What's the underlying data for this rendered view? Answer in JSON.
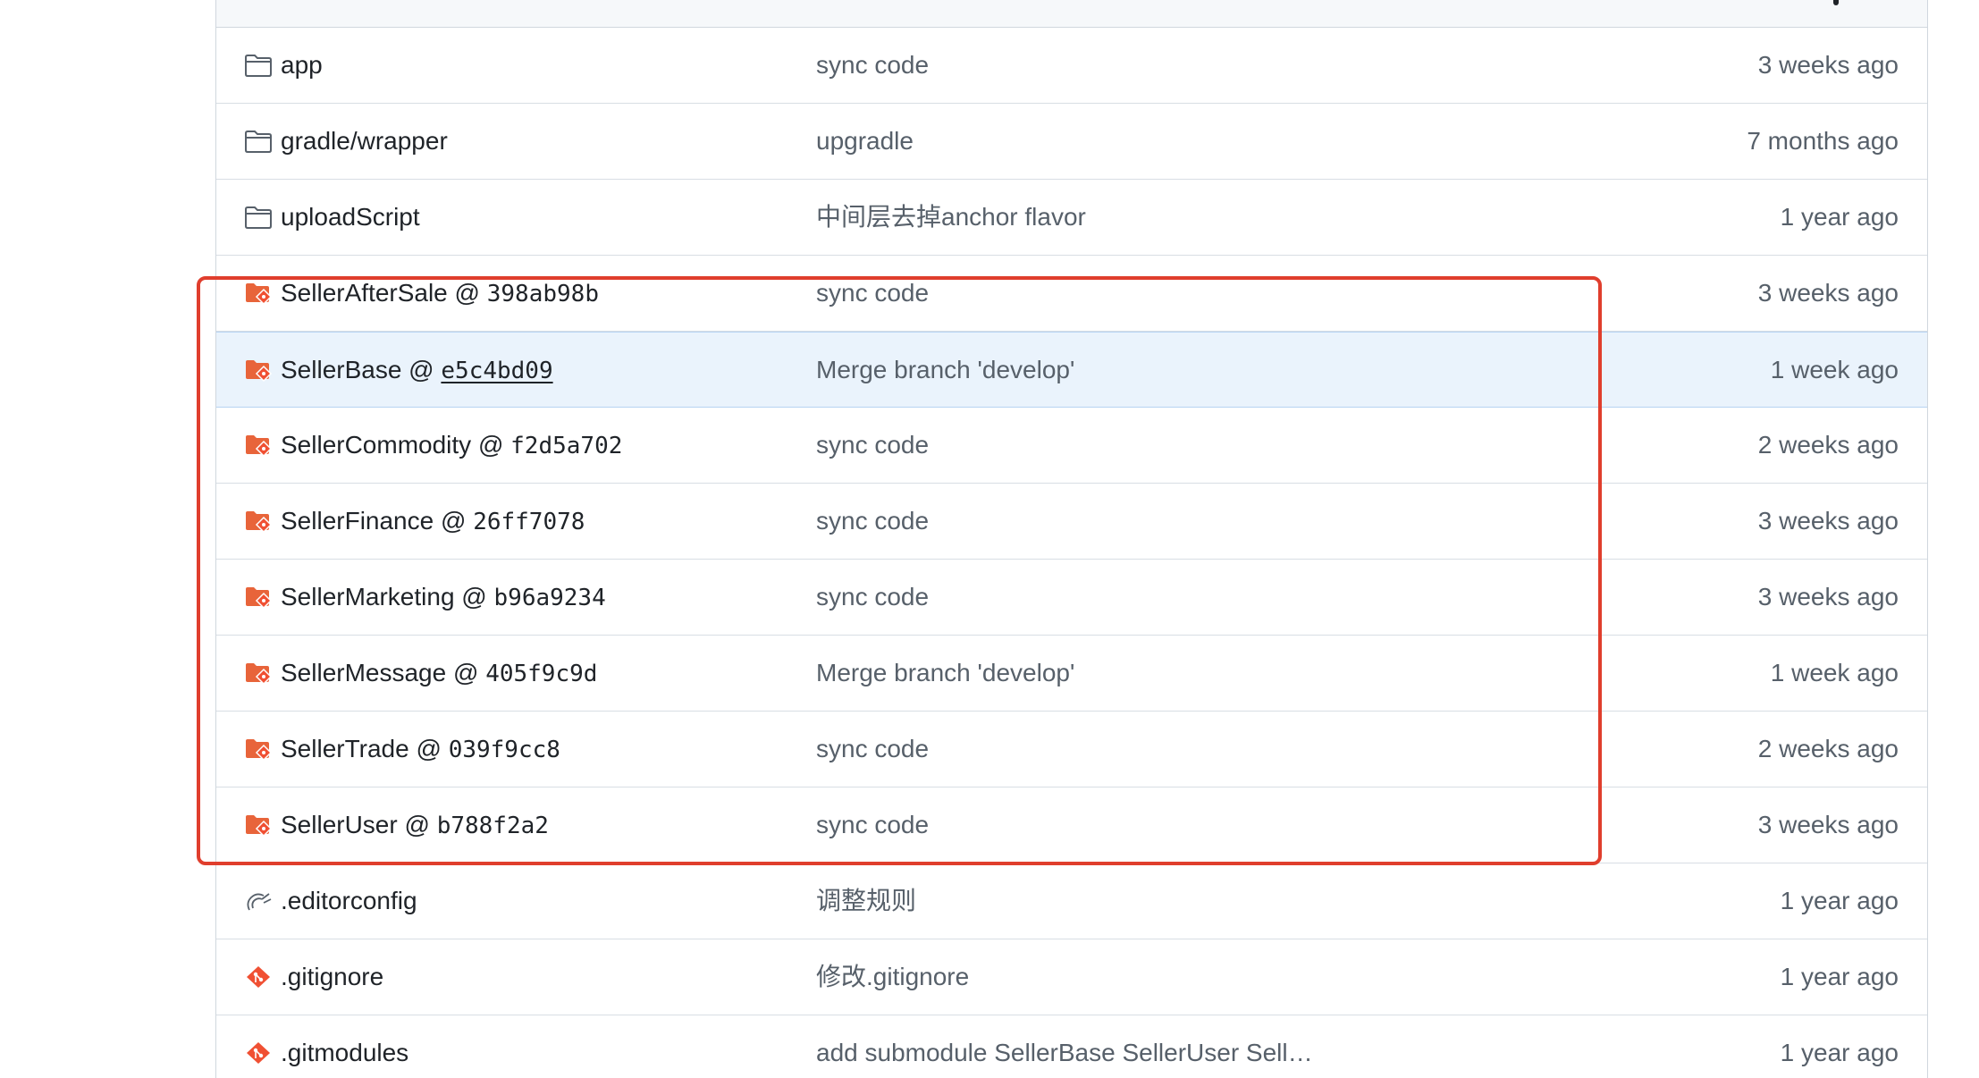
{
  "files": [
    {
      "type": "folder",
      "icon": "folder-icon",
      "name": "app",
      "hash": "",
      "message": "sync code",
      "age": "3 weeks ago"
    },
    {
      "type": "folder",
      "icon": "folder-icon",
      "name": "gradle/wrapper",
      "hash": "",
      "message": "upgradle",
      "age": "7 months ago"
    },
    {
      "type": "folder",
      "icon": "folder-icon",
      "name": "uploadScript",
      "hash": "",
      "message": "中间层去掉anchor flavor",
      "age": "1 year ago"
    },
    {
      "type": "submodule",
      "icon": "submodule-folder-icon",
      "name": "SellerAfterSale @ ",
      "hash": "398ab98b",
      "message": "sync code",
      "age": "3 weeks ago"
    },
    {
      "type": "submodule",
      "icon": "submodule-folder-icon",
      "name": "SellerBase @ ",
      "hash": "e5c4bd09",
      "message": "Merge branch 'develop'",
      "age": "1 week ago"
    },
    {
      "type": "submodule",
      "icon": "submodule-folder-icon",
      "name": "SellerCommodity @ ",
      "hash": "f2d5a702",
      "message": "sync code",
      "age": "2 weeks ago"
    },
    {
      "type": "submodule",
      "icon": "submodule-folder-icon",
      "name": "SellerFinance @ ",
      "hash": "26ff7078",
      "message": "sync code",
      "age": "3 weeks ago"
    },
    {
      "type": "submodule",
      "icon": "submodule-folder-icon",
      "name": "SellerMarketing @ ",
      "hash": "b96a9234",
      "message": "sync code",
      "age": "3 weeks ago"
    },
    {
      "type": "submodule",
      "icon": "submodule-folder-icon",
      "name": "SellerMessage @ ",
      "hash": "405f9c9d",
      "message": "Merge branch 'develop'",
      "age": "1 week ago"
    },
    {
      "type": "submodule",
      "icon": "submodule-folder-icon",
      "name": "SellerTrade @ ",
      "hash": "039f9cc8",
      "message": "sync code",
      "age": "2 weeks ago"
    },
    {
      "type": "submodule",
      "icon": "submodule-folder-icon",
      "name": "SellerUser @ ",
      "hash": "b788f2a2",
      "message": "sync code",
      "age": "3 weeks ago"
    },
    {
      "type": "file",
      "icon": "editorconfig-icon",
      "name": ".editorconfig",
      "hash": "",
      "message": "调整规则",
      "age": "1 year ago"
    },
    {
      "type": "file",
      "icon": "git-icon",
      "name": ".gitignore",
      "hash": "",
      "message": "修改.gitignore",
      "age": "1 year ago"
    },
    {
      "type": "file",
      "icon": "git-icon",
      "name": ".gitmodules",
      "hash": "",
      "message": "add submodule SellerBase SellerUser Sell…",
      "age": "1 year ago"
    }
  ],
  "colors": {
    "submodule_accent": "#e8643a",
    "highlight_border": "#e03e2d",
    "hover_row": "#eaf3fc",
    "text_primary": "#1f2328",
    "text_muted": "#57606a"
  }
}
